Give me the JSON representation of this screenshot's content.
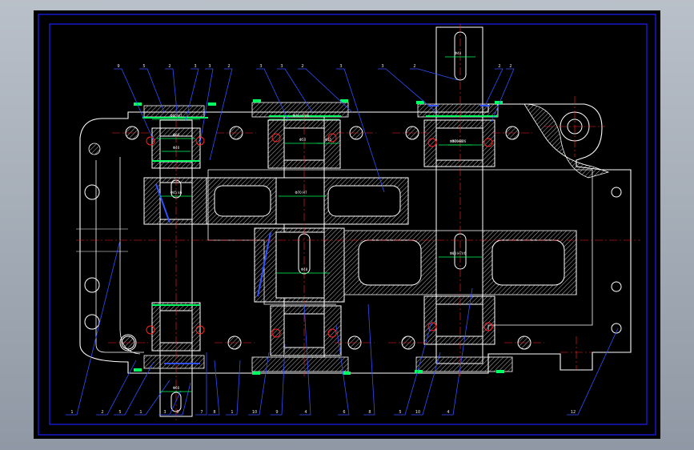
{
  "colors": {
    "background": "#000000",
    "outline": "#ffffff",
    "border": "#1e1eff",
    "centerline": "#ff2020",
    "fastener": "#00ff60",
    "leader": "#3050ff",
    "hatch": "#ffffff"
  },
  "callouts_top": {
    "t1": "9",
    "t2": "5",
    "t3": "2",
    "t4": "3",
    "t5": "3",
    "t6": "2",
    "t7": "3",
    "t8": "3",
    "t9": "2",
    "t10": "3",
    "t11": "3",
    "t12": "2",
    "t13": "2",
    "t14": "2"
  },
  "callouts_bottom": {
    "b1": "1",
    "b2": "2",
    "b3": "5",
    "b4": "1",
    "b5": "3",
    "b6": "8",
    "b7": "7",
    "b8": "8",
    "b9": "1",
    "b10": "10",
    "b11": "9",
    "b12": "4",
    "b13": "6",
    "b14": "8",
    "b15": "5",
    "b16": "10",
    "b17": "4",
    "b18": "12"
  },
  "dimensions": {
    "d1": "Φ60 H7",
    "d2": "Φ60",
    "d3": "Φ40",
    "d4": "Φ45 k6",
    "d5": "Φ70 H7/r6",
    "d6": "Φ50",
    "d7": "Φ55",
    "d8": "Φ70 H7",
    "d9": "Φ48",
    "d10": "Φ70 H7/r6",
    "d11": "Φ80 H7/r6",
    "d12": "Φ70 H7",
    "d13": "Φ60",
    "d14": "Φ40"
  }
}
